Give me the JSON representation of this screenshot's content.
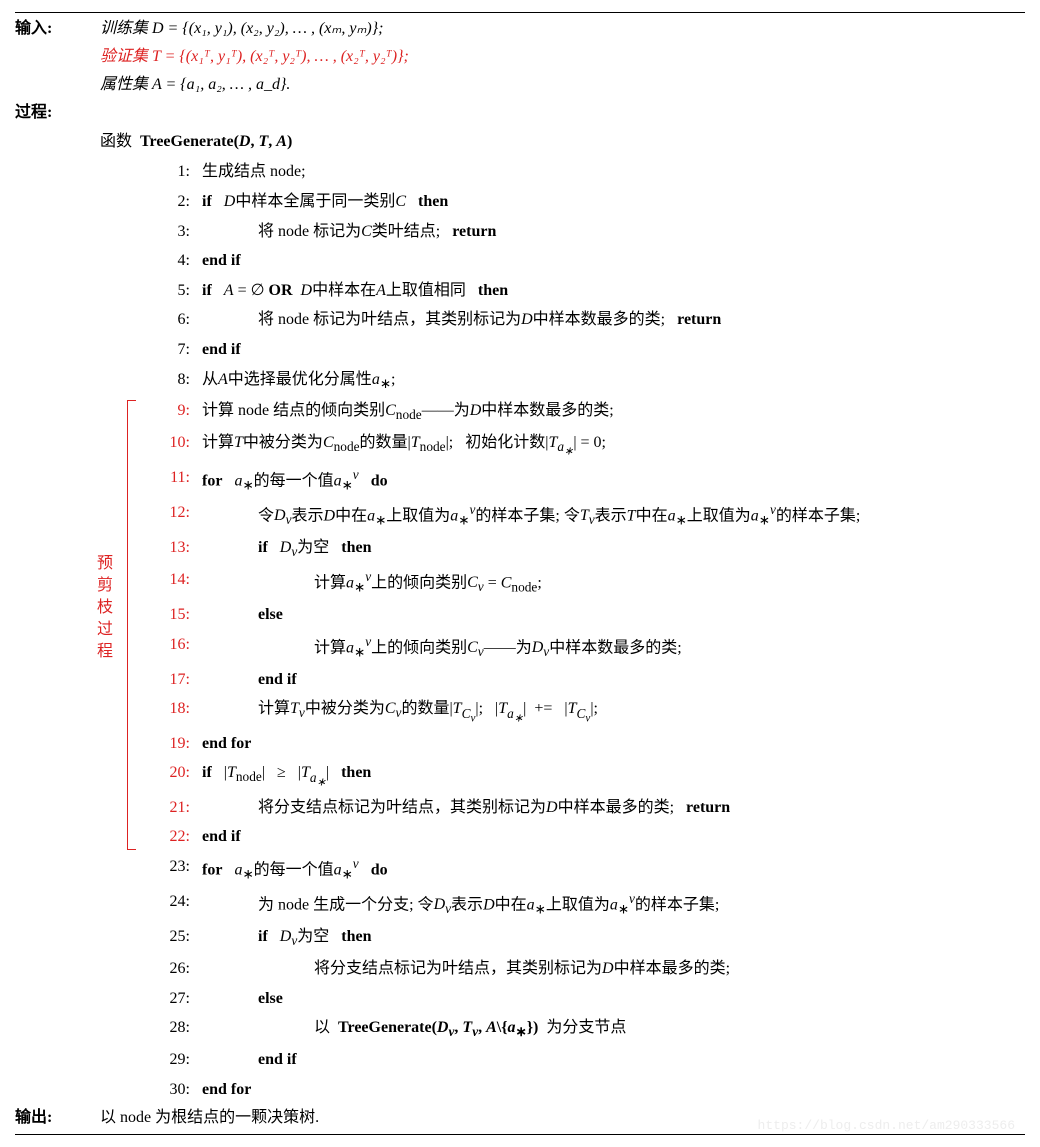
{
  "header": {
    "input_label": "输入:",
    "train_set": "训练集  D = {(x₁, y₁), (x₂, y₂), … , (xₘ, yₘ)};",
    "valid_set": "验证集  T = {(x₁ᵀ, y₁ᵀ), (x₂ᵀ, y₂ᵀ), … , (x₂ᵀ, y₂ᵀ)};",
    "attr_set": "属性集  A = {a₁, a₂, … , a_d}.",
    "process_label": "过程:",
    "func_label": "函数",
    "func_sig": "TreeGenerate(D, T, A)",
    "output_label": "输出:",
    "output_text": "以 node 为根结点的一颗决策树."
  },
  "side": {
    "label": "预剪枝过程"
  },
  "lines": [
    {
      "n": "1:",
      "red": false,
      "ind": 0,
      "html": "生成结点 node;"
    },
    {
      "n": "2:",
      "red": false,
      "ind": 0,
      "html": "<span class='kw'>if</span>&nbsp;&nbsp;&nbsp;<span class='math'>D</span>中样本全属于同一类别<span class='math'>C</span>&nbsp;&nbsp;&nbsp;<span class='kw'>then</span>"
    },
    {
      "n": "3:",
      "red": false,
      "ind": 2,
      "html": "将 node 标记为<span class='math'>C</span>类叶结点;&nbsp;&nbsp;&nbsp;<span class='kw'>return</span>"
    },
    {
      "n": "4:",
      "red": false,
      "ind": 0,
      "html": "<span class='kw'>end if</span>"
    },
    {
      "n": "5:",
      "red": false,
      "ind": 0,
      "html": "<span class='kw'>if</span>&nbsp;&nbsp;&nbsp;<span class='math'>A</span> = ∅ <span class='kw'>OR</span>&nbsp; <span class='math'>D</span>中样本在<span class='math'>A</span>上取值相同&nbsp;&nbsp;&nbsp;<span class='kw'>then</span>"
    },
    {
      "n": "6:",
      "red": false,
      "ind": 2,
      "html": "将 node 标记为叶结点，其类别标记为<span class='math'>D</span>中样本数最多的类;&nbsp;&nbsp;&nbsp;<span class='kw'>return</span>"
    },
    {
      "n": "7:",
      "red": false,
      "ind": 0,
      "html": "<span class='kw'>end if</span>"
    },
    {
      "n": "8:",
      "red": false,
      "ind": 0,
      "html": "从<span class='math'>A</span>中选择最优化分属性<span class='math'>a</span><sub>∗</sub>;"
    },
    {
      "n": "9:",
      "red": true,
      "ind": 0,
      "html": "计算 node 结点的倾向类别<span class='math'>C</span><sub>node</sub>——为<span class='math'>D</span>中样本数最多的类;"
    },
    {
      "n": "10:",
      "red": true,
      "ind": 0,
      "html": "计算<span class='math'>T</span>中被分类为<span class='math'>C</span><sub>node</sub>的数量|<span class='math'>T</span><sub>node</sub>|;&nbsp;&nbsp; 初始化计数|<span class='math'>T<sub>a<sub>∗</sub></sub></span>| = 0;"
    },
    {
      "n": "11:",
      "red": true,
      "ind": 0,
      "html": "<span class='kw'>for</span>&nbsp;&nbsp;&nbsp;<span class='math'>a</span><sub>∗</sub>的每一个值<span class='math'>a</span><sub>∗</sub><sup><span class='math'>v</span></sup>&nbsp;&nbsp;&nbsp;<span class='kw'>do</span>"
    },
    {
      "n": "12:",
      "red": true,
      "ind": 2,
      "html": "令<span class='math'>D<sub>v</sub></span>表示<span class='math'>D</span>中在<span class='math'>a</span><sub>∗</sub>上取值为<span class='math'>a</span><sub>∗</sub><sup><span class='math'>v</span></sup>的样本子集; 令<span class='math'>T<sub>v</sub></span>表示<span class='math'>T</span>中在<span class='math'>a</span><sub>∗</sub>上取值为<span class='math'>a</span><sub>∗</sub><sup><span class='math'>v</span></sup>的样本子集;"
    },
    {
      "n": "13:",
      "red": true,
      "ind": 2,
      "html": "<span class='kw'>if</span>&nbsp;&nbsp;&nbsp;<span class='math'>D<sub>v</sub></span>为空&nbsp;&nbsp;&nbsp;<span class='kw'>then</span>"
    },
    {
      "n": "14:",
      "red": true,
      "ind": 4,
      "html": "计算<span class='math'>a</span><sub>∗</sub><sup><span class='math'>v</span></sup>上的倾向类别<span class='math'>C<sub>v</sub></span> = <span class='math'>C</span><sub>node</sub>;"
    },
    {
      "n": "15:",
      "red": true,
      "ind": 2,
      "html": "<span class='kw'>else</span>"
    },
    {
      "n": "16:",
      "red": true,
      "ind": 4,
      "html": "计算<span class='math'>a</span><sub>∗</sub><sup><span class='math'>v</span></sup>上的倾向类别<span class='math'>C<sub>v</sub></span>——为<span class='math'>D<sub>v</sub></span>中样本数最多的类;"
    },
    {
      "n": "17:",
      "red": true,
      "ind": 2,
      "html": "<span class='kw'>end if</span>"
    },
    {
      "n": "18:",
      "red": true,
      "ind": 2,
      "html": "计算<span class='math'>T<sub>v</sub></span>中被分类为<span class='math'>C<sub>v</sub></span>的数量|<span class='math'>T<sub>C<sub>v</sub></sub></span>|;&nbsp;&nbsp;&nbsp;|<span class='math'>T<sub>a<sub>∗</sub></sub></span>|&nbsp;&nbsp;+=&nbsp;&nbsp;&nbsp;|<span class='math'>T<sub>C<sub>v</sub></sub></span>|;"
    },
    {
      "n": "19:",
      "red": true,
      "ind": 0,
      "html": "<span class='kw'>end for</span>"
    },
    {
      "n": "20:",
      "red": true,
      "ind": 0,
      "html": "<span class='kw'>if</span>&nbsp;&nbsp;&nbsp;|<span class='math'>T</span><sub>node</sub>|&nbsp;&nbsp;&nbsp;≥&nbsp;&nbsp;&nbsp;|<span class='math'>T<sub>a<sub>∗</sub></sub></span>|&nbsp;&nbsp;&nbsp;<span class='kw'>then</span>"
    },
    {
      "n": "21:",
      "red": true,
      "ind": 2,
      "html": "将分支结点标记为叶结点，其类别标记为<span class='math'>D</span>中样本最多的类;&nbsp;&nbsp;&nbsp;<span class='kw'>return</span>"
    },
    {
      "n": "22:",
      "red": true,
      "ind": 0,
      "html": "<span class='kw'>end if</span>"
    },
    {
      "n": "23:",
      "red": false,
      "ind": 0,
      "html": "<span class='kw'>for</span>&nbsp;&nbsp;&nbsp;<span class='math'>a</span><sub>∗</sub>的每一个值<span class='math'>a</span><sub>∗</sub><sup><span class='math'>v</span></sup>&nbsp;&nbsp;&nbsp;<span class='kw'>do</span>"
    },
    {
      "n": "24:",
      "red": false,
      "ind": 2,
      "html": "为 node 生成一个分支; 令<span class='math'>D<sub>v</sub></span>表示<span class='math'>D</span>中在<span class='math'>a</span><sub>∗</sub>上取值为<span class='math'>a</span><sub>∗</sub><sup><span class='math'>v</span></sup>的样本子集;"
    },
    {
      "n": "25:",
      "red": false,
      "ind": 2,
      "html": "<span class='kw'>if</span>&nbsp;&nbsp;&nbsp;<span class='math'>D<sub>v</sub></span>为空&nbsp;&nbsp;&nbsp;<span class='kw'>then</span>"
    },
    {
      "n": "26:",
      "red": false,
      "ind": 4,
      "html": "将分支结点标记为叶结点，其类别标记为<span class='math'>D</span>中样本最多的类;"
    },
    {
      "n": "27:",
      "red": false,
      "ind": 2,
      "html": "<span class='kw'>else</span>"
    },
    {
      "n": "28:",
      "red": false,
      "ind": 4,
      "html": "以&nbsp;&nbsp;<span class='func'>TreeGenerate(<span class='math'>D<sub>v</sub></span>, <span class='math'>T<sub>v</sub></span>, <span class='math'>A</span>\\{<span class='math'>a</span><sub>∗</sub>})</span>&nbsp;&nbsp;为分支节点"
    },
    {
      "n": "29:",
      "red": false,
      "ind": 2,
      "html": "<span class='kw'>end if</span>"
    },
    {
      "n": "30:",
      "red": false,
      "ind": 0,
      "html": "<span class='kw'>end for</span>"
    }
  ],
  "watermark": "https://blog.csdn.net/am290333566"
}
